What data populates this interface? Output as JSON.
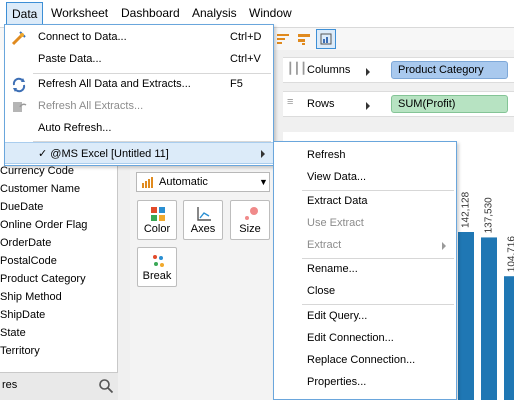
{
  "menubar": {
    "items": [
      "Data",
      "Worksheet",
      "Dashboard",
      "Analysis",
      "Window"
    ]
  },
  "data_menu": {
    "connect": {
      "label": "Connect to Data...",
      "shortcut": "Ctrl+D"
    },
    "paste": {
      "label": "Paste Data...",
      "shortcut": "Ctrl+V"
    },
    "refresh_all": {
      "label": "Refresh All Data and Extracts...",
      "shortcut": "F5"
    },
    "refresh_extracts": {
      "label": "Refresh All Extracts..."
    },
    "auto_refresh": {
      "label": "Auto Refresh..."
    },
    "datasource": {
      "label": "✓ @MS Excel [Untitled 11]"
    }
  },
  "submenu": {
    "refresh": "Refresh",
    "view_data": "View Data...",
    "extract_data": "Extract Data",
    "use_extract": "Use Extract",
    "extract": "Extract",
    "rename": "Rename...",
    "close": "Close",
    "edit_query": "Edit Query...",
    "edit_connection": "Edit Connection...",
    "replace_connection": "Replace Connection...",
    "properties": "Properties..."
  },
  "fields": [
    "Currency Code",
    "Customer Name",
    "DueDate",
    "Online Order Flag",
    "OrderDate",
    "PostalCode",
    "Product Category",
    "Ship Method",
    "ShipDate",
    "State",
    "Territory"
  ],
  "search": {
    "label": "res"
  },
  "marks": {
    "type": "Automatic",
    "buttons": {
      "color": "Color",
      "axes": "Axes",
      "size": "Size",
      "break": "Break"
    }
  },
  "shelves": {
    "columns": {
      "label": "Columns",
      "pill": "Product Category"
    },
    "rows": {
      "label": "Rows",
      "pill": "SUM(Profit)"
    }
  },
  "chart_data": {
    "type": "bar",
    "values": [
      142128,
      137530,
      104716
    ],
    "labels": [
      "142,128",
      "137,530",
      "104,716"
    ]
  },
  "colors": {
    "accent": "#3d8fd6",
    "bar": "#1f77b4",
    "columns_pill": "#a9c9ee",
    "rows_pill": "#b7e3c2"
  }
}
